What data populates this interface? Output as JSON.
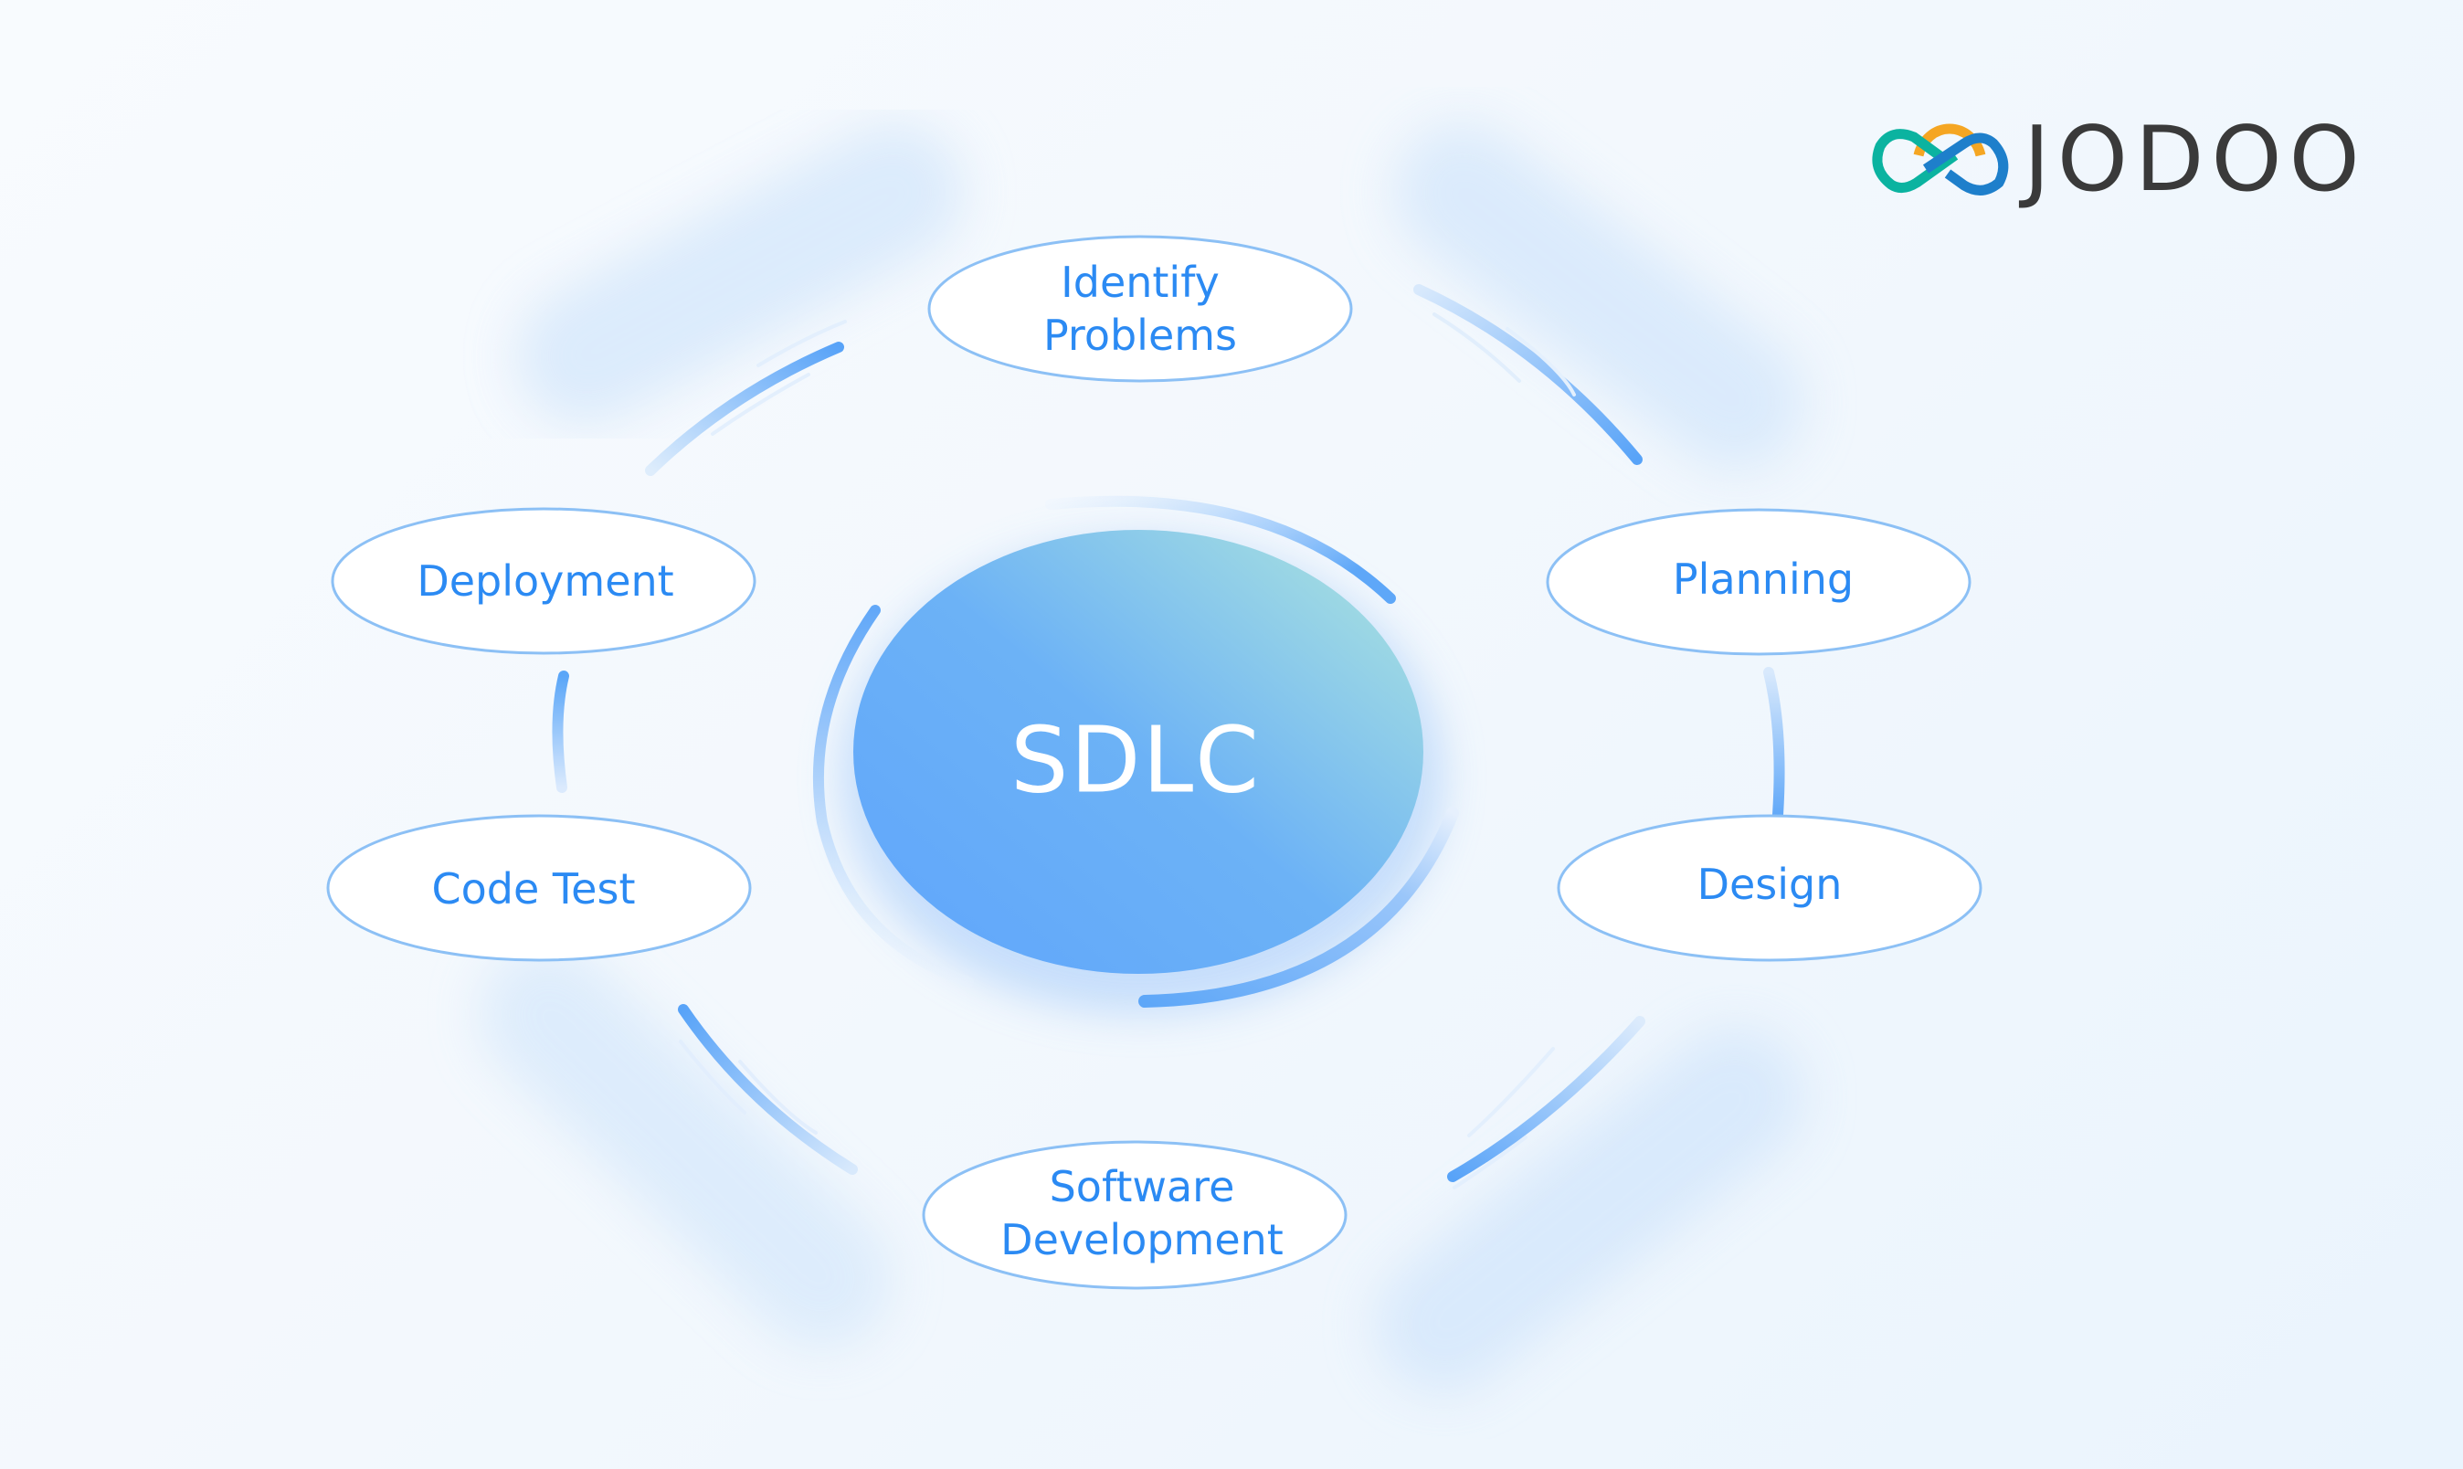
{
  "diagram": {
    "title": "SDLC",
    "center_label": "SDLC",
    "stages": [
      {
        "id": "identify-problems",
        "label": "Identify\nProblems"
      },
      {
        "id": "planning",
        "label": "Planning"
      },
      {
        "id": "design",
        "label": "Design"
      },
      {
        "id": "software-development",
        "label": "Software\nDevelopment"
      },
      {
        "id": "code-test",
        "label": "Code Test"
      },
      {
        "id": "deployment",
        "label": "Deployment"
      }
    ],
    "flow": "clockwise",
    "colors": {
      "node_text": "#2b8af3",
      "node_border": "#8cc0f5",
      "node_fill": "#ffffff",
      "center_gradient_start": "#66abf8",
      "center_gradient_end": "#a3dce0",
      "connector": "#5aa6f8"
    }
  },
  "logo": {
    "text": "JODOO",
    "icon": "jodoo-infinity-logo-icon",
    "colors": {
      "orange": "#f5a623",
      "teal": "#0bb3a0",
      "blue": "#1e7fcb",
      "text": "#3a3a3a"
    }
  }
}
